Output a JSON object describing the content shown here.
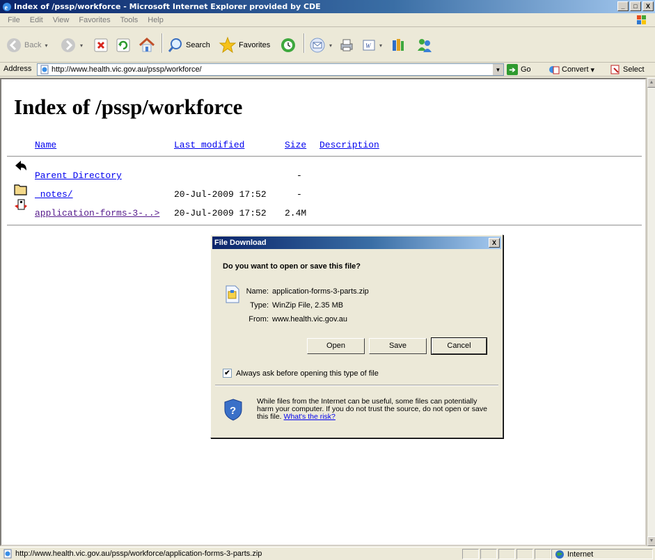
{
  "window": {
    "title": "Index of /pssp/workforce - Microsoft Internet Explorer provided by CDE",
    "controls": [
      "_",
      "□",
      "X"
    ]
  },
  "menu": [
    "File",
    "Edit",
    "View",
    "Favorites",
    "Tools",
    "Help"
  ],
  "toolbar": {
    "back_label": "Back",
    "search_label": "Search",
    "favorites_label": "Favorites"
  },
  "addressbar": {
    "label": "Address",
    "url": "http://www.health.vic.gov.au/pssp/workforce/",
    "go_label": "Go",
    "convert_label": "Convert",
    "select_label": "Select"
  },
  "page": {
    "heading": "Index of /pssp/workforce",
    "columns": {
      "name": "Name",
      "last_modified": "Last modified",
      "size": "Size",
      "description": "Description"
    },
    "rows": [
      {
        "name": "Parent Directory",
        "modified": "",
        "size": "-",
        "icon": "back-arrow-icon"
      },
      {
        "name": "_notes/",
        "modified": "20-Jul-2009 17:52",
        "size": "-",
        "icon": "folder-icon"
      },
      {
        "name": "application-forms-3-..>",
        "modified": "20-Jul-2009 17:52",
        "size": "2.4M",
        "icon": "compressed-file-icon"
      }
    ]
  },
  "dialog": {
    "title": "File Download",
    "close": "X",
    "question": "Do you want to open or save this file?",
    "name_label": "Name:",
    "name_value": "application-forms-3-parts.zip",
    "type_label": "Type:",
    "type_value": "WinZip File, 2.35 MB",
    "from_label": "From:",
    "from_value": "www.health.vic.gov.au",
    "open_label": "Open",
    "save_label": "Save",
    "cancel_label": "Cancel",
    "checkbox_label": "Always ask before opening this type of file",
    "checkbox_checked": true,
    "warning_text": "While files from the Internet can be useful, some files can potentially harm your computer. If you do not trust the source, do not open or save this file.",
    "risk_link": "What's the risk?"
  },
  "status": {
    "url": "http://www.health.vic.gov.au/pssp/workforce/application-forms-3-parts.zip",
    "zone": "Internet"
  }
}
